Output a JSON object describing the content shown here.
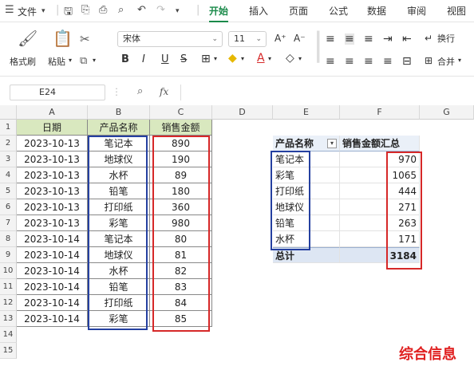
{
  "menu": {
    "file": "文件",
    "tabs": [
      "开始",
      "插入",
      "页面",
      "公式",
      "数据",
      "审阅",
      "视图"
    ]
  },
  "ribbon": {
    "format_painter": "格式刷",
    "paste": "粘贴",
    "font_name": "宋体",
    "font_size": "11",
    "bold": "B",
    "italic": "I",
    "underline": "U",
    "strike": "S",
    "increase_font": "A⁺",
    "decrease_font": "A⁻",
    "wrap": "换行",
    "merge": "合并"
  },
  "formula_bar": {
    "cell_ref": "E24",
    "fx": "fx"
  },
  "columns": [
    "A",
    "B",
    "C",
    "D",
    "E",
    "F",
    "G"
  ],
  "rows": [
    "1",
    "2",
    "3",
    "4",
    "5",
    "6",
    "7",
    "8",
    "9",
    "10",
    "11",
    "12",
    "13",
    "14",
    "15"
  ],
  "source_table": {
    "headers": [
      "日期",
      "产品名称",
      "销售金额"
    ],
    "rows": [
      [
        "2023-10-13",
        "笔记本",
        "890"
      ],
      [
        "2023-10-13",
        "地球仪",
        "190"
      ],
      [
        "2023-10-13",
        "水杯",
        "89"
      ],
      [
        "2023-10-13",
        "铅笔",
        "180"
      ],
      [
        "2023-10-13",
        "打印纸",
        "360"
      ],
      [
        "2023-10-13",
        "彩笔",
        "980"
      ],
      [
        "2023-10-14",
        "笔记本",
        "80"
      ],
      [
        "2023-10-14",
        "地球仪",
        "81"
      ],
      [
        "2023-10-14",
        "水杯",
        "82"
      ],
      [
        "2023-10-14",
        "铅笔",
        "83"
      ],
      [
        "2023-10-14",
        "打印纸",
        "84"
      ],
      [
        "2023-10-14",
        "彩笔",
        "85"
      ]
    ]
  },
  "pivot": {
    "header_row_label": "产品名称",
    "header_value": "销售金额汇总",
    "rows": [
      [
        "笔记本",
        "970"
      ],
      [
        "彩笔",
        "1065"
      ],
      [
        "打印纸",
        "444"
      ],
      [
        "地球仪",
        "271"
      ],
      [
        "铅笔",
        "263"
      ],
      [
        "水杯",
        "171"
      ]
    ],
    "total_label": "总计",
    "total_value": "3184"
  },
  "watermark": "综合信息",
  "colors": {
    "accent": "#1a8a4a",
    "header_fill": "#d9e8bf",
    "blue_box": "#2540a0",
    "red_box": "#d62828"
  }
}
